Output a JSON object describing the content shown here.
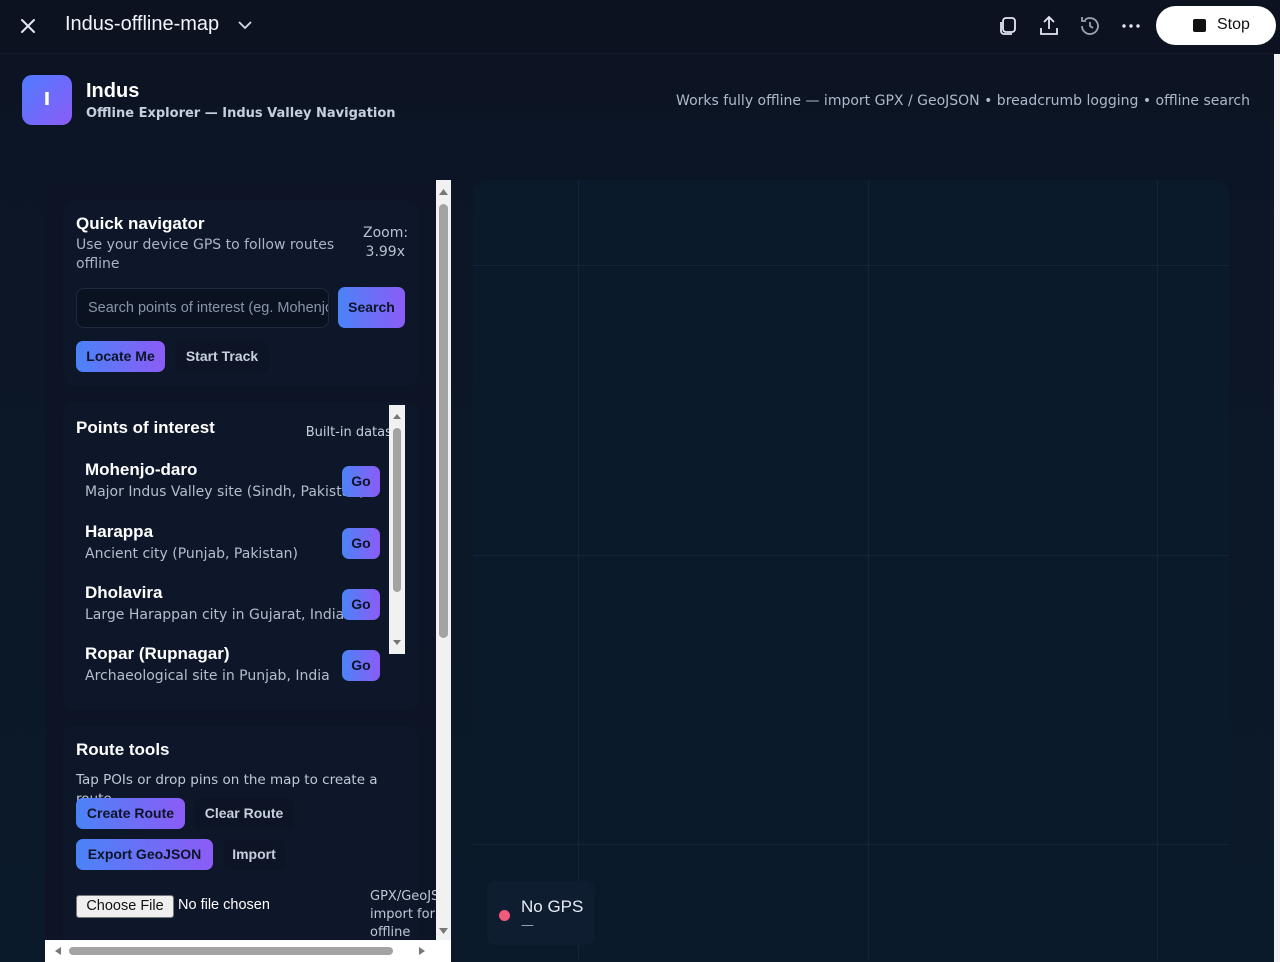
{
  "window": {
    "title": "Indus-offline-map",
    "stop_label": "Stop"
  },
  "header": {
    "logo_letter": "I",
    "app_name": "Indus",
    "subtitle": "Offline Explorer — Indus Valley Navigation",
    "tagline": "Works fully offline — import GPX / GeoJSON • breadcrumb logging • offline search"
  },
  "navigator": {
    "title": "Quick navigator",
    "description": "Use your device GPS to follow routes offline",
    "zoom_label": "Zoom:",
    "zoom_value": "3.99x",
    "search_placeholder": "Search points of interest (eg. Mohenjo-daro)",
    "search_button": "Search",
    "locate_button": "Locate Me",
    "track_button": "Start Track"
  },
  "poi": {
    "title": "Points of interest",
    "dataset_label": "Built-in dataset",
    "go_label": "Go",
    "items": [
      {
        "name": "Mohenjo-daro",
        "desc": "Major Indus Valley site (Sindh, Pakistan)"
      },
      {
        "name": "Harappa",
        "desc": "Ancient city (Punjab, Pakistan)"
      },
      {
        "name": "Dholavira",
        "desc": "Large Harappan city in Gujarat, India"
      },
      {
        "name": "Ropar (Rupnagar)",
        "desc": "Archaeological site in Punjab, India"
      }
    ]
  },
  "route": {
    "title": "Route tools",
    "hint": "Tap POIs or drop pins on the map to create a route.",
    "create_button": "Create Route",
    "clear_button": "Clear Route",
    "export_button": "Export GeoJSON",
    "import_button": "Import",
    "file_button": "Choose File",
    "file_status": "No file chosen",
    "gpx_note": "GPX/GeoJSON import for offline routes"
  },
  "map": {
    "gps_status": "No GPS",
    "gps_sub": "—",
    "gps_dot_color": "#f25a7a"
  },
  "colors": {
    "accent_start": "#4b83f7",
    "accent_end": "#8b5cf6",
    "background": "#0c1322"
  }
}
